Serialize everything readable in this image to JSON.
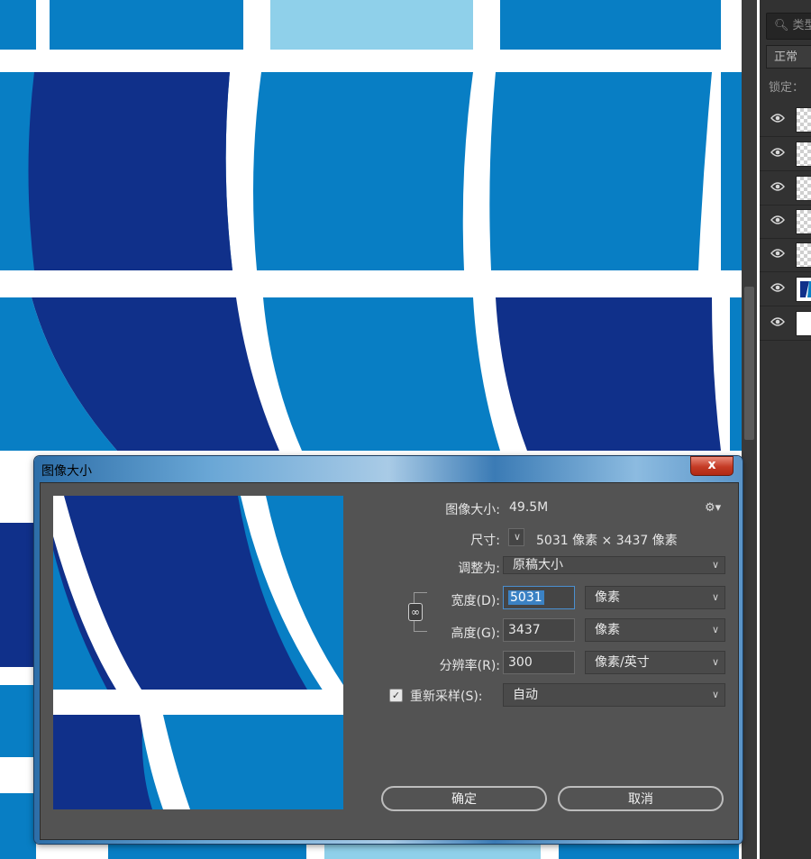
{
  "background_art": {
    "colors": {
      "dark_blue": "#10308a",
      "mid_blue": "#087ec4",
      "light_blue": "#8fd0ea",
      "stripe": "#ffffff"
    }
  },
  "layers_panel": {
    "search_placeholder": "类型",
    "blend_mode": "正常",
    "lock_label": "锁定：",
    "layers": [
      {
        "thumb": "checker"
      },
      {
        "thumb": "checker"
      },
      {
        "thumb": "checker"
      },
      {
        "thumb": "checker"
      },
      {
        "thumb": "checker"
      },
      {
        "thumb": "image"
      },
      {
        "thumb": "white"
      }
    ]
  },
  "dialog": {
    "title": "图像大小",
    "close_label": "x",
    "image_size_label": "图像大小:",
    "image_size_value": "49.5M",
    "dimensions_label": "尺寸:",
    "dimensions_value": "5031 像素  ×  3437 像素",
    "fit_to_label": "调整为:",
    "fit_to_value": "原稿大小",
    "width_label": "宽度(D):",
    "width_value": "5031",
    "width_unit": "像素",
    "height_label": "高度(G):",
    "height_value": "3437",
    "height_unit": "像素",
    "resolution_label": "分辨率(R):",
    "resolution_value": "300",
    "resolution_unit": "像素/英寸",
    "resample_label": "重新采样(S):",
    "resample_checked": true,
    "resample_value": "自动",
    "ok_label": "确定",
    "cancel_label": "取消"
  }
}
